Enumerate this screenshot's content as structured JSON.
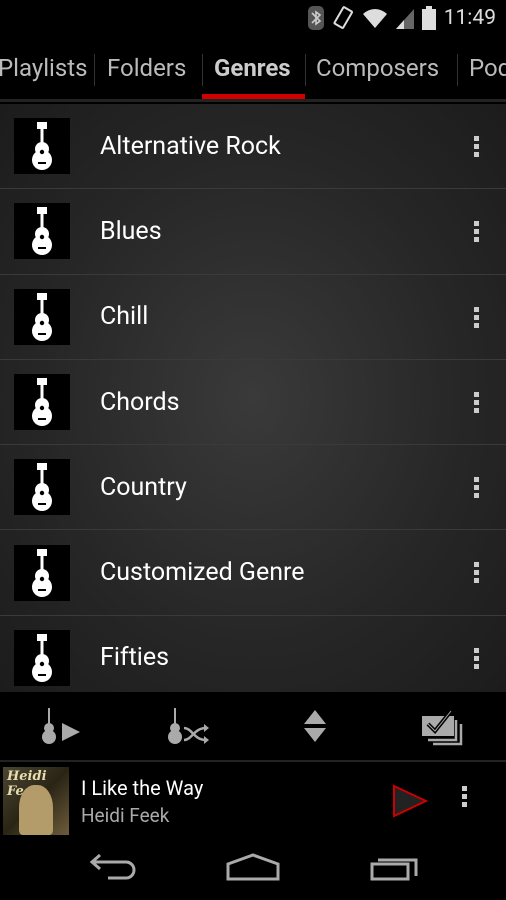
{
  "status": {
    "time": "11:49",
    "icons": [
      "bluetooth-icon",
      "vibrate-icon",
      "wifi-icon",
      "signal-icon",
      "battery-icon"
    ]
  },
  "tabs": [
    {
      "label": "Playlists"
    },
    {
      "label": "Folders"
    },
    {
      "label": "Genres",
      "active": true
    },
    {
      "label": "Composers"
    },
    {
      "label": "Pod"
    }
  ],
  "genres": [
    {
      "label": "Alternative Rock"
    },
    {
      "label": "Blues"
    },
    {
      "label": "Chill"
    },
    {
      "label": "Chords"
    },
    {
      "label": "Country"
    },
    {
      "label": "Customized Genre"
    },
    {
      "label": "Fifties"
    }
  ],
  "toolbar": [
    "play-genre-icon",
    "shuffle-genre-icon",
    "sort-icon",
    "select-multiple-icon"
  ],
  "now_playing": {
    "title": "I Like the Way",
    "artist": "Heidi Feek",
    "album_art_text": "Heidi Feek"
  },
  "colors": {
    "accent": "#d10000"
  }
}
